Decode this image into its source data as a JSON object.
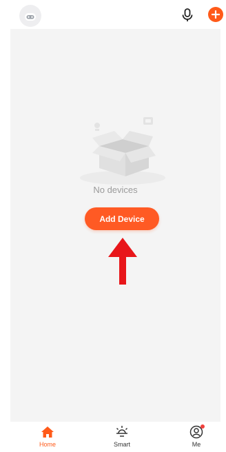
{
  "colors": {
    "accent": "#ff5a19",
    "button": "#ff5a24",
    "annotation_arrow": "#e8161a",
    "content_bg": "#f4f4f4",
    "placeholder_text": "#9a9a9a"
  },
  "header": {
    "avatar_icon": "robot-avatar-icon",
    "mic_icon": "microphone-icon",
    "add_icon": "plus-circle-icon"
  },
  "main": {
    "empty_illustration": "empty-box-icon",
    "empty_text": "No devices",
    "add_device_label": "Add Device"
  },
  "tabbar": {
    "tabs": [
      {
        "label": "Home",
        "icon": "home-icon",
        "active": true
      },
      {
        "label": "Smart",
        "icon": "sun-icon",
        "active": false
      },
      {
        "label": "Me",
        "icon": "user-icon",
        "active": false,
        "badge": true
      }
    ]
  }
}
